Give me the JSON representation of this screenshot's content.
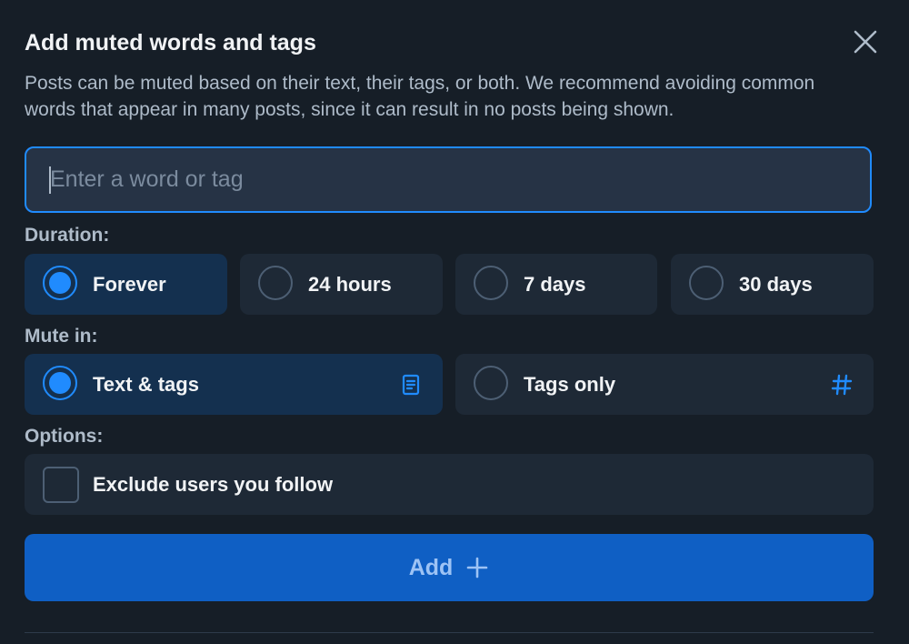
{
  "dialog": {
    "title": "Add muted words and tags",
    "description": "Posts can be muted based on their text, their tags, or both. We recommend avoiding common words that appear in many posts, since it can result in no posts being shown.",
    "close_icon": "close-icon"
  },
  "input": {
    "placeholder": "Enter a word or tag",
    "value": ""
  },
  "duration": {
    "label": "Duration:",
    "options": [
      {
        "label": "Forever",
        "selected": true
      },
      {
        "label": "24 hours",
        "selected": false
      },
      {
        "label": "7 days",
        "selected": false
      },
      {
        "label": "30 days",
        "selected": false
      }
    ]
  },
  "mute_in": {
    "label": "Mute in:",
    "options": [
      {
        "label": "Text & tags",
        "selected": true,
        "icon": "document-icon"
      },
      {
        "label": "Tags only",
        "selected": false,
        "icon": "hashtag-icon"
      }
    ]
  },
  "options": {
    "label": "Options:",
    "exclude_following": {
      "label": "Exclude users you follow",
      "checked": false
    }
  },
  "add_button": {
    "label": "Add",
    "icon": "plus-icon"
  },
  "colors": {
    "background": "#161e27",
    "accent": "#208bfe",
    "button": "#0f5fc4",
    "option_bg": "#1e2936",
    "option_selected_bg": "#14304f"
  }
}
